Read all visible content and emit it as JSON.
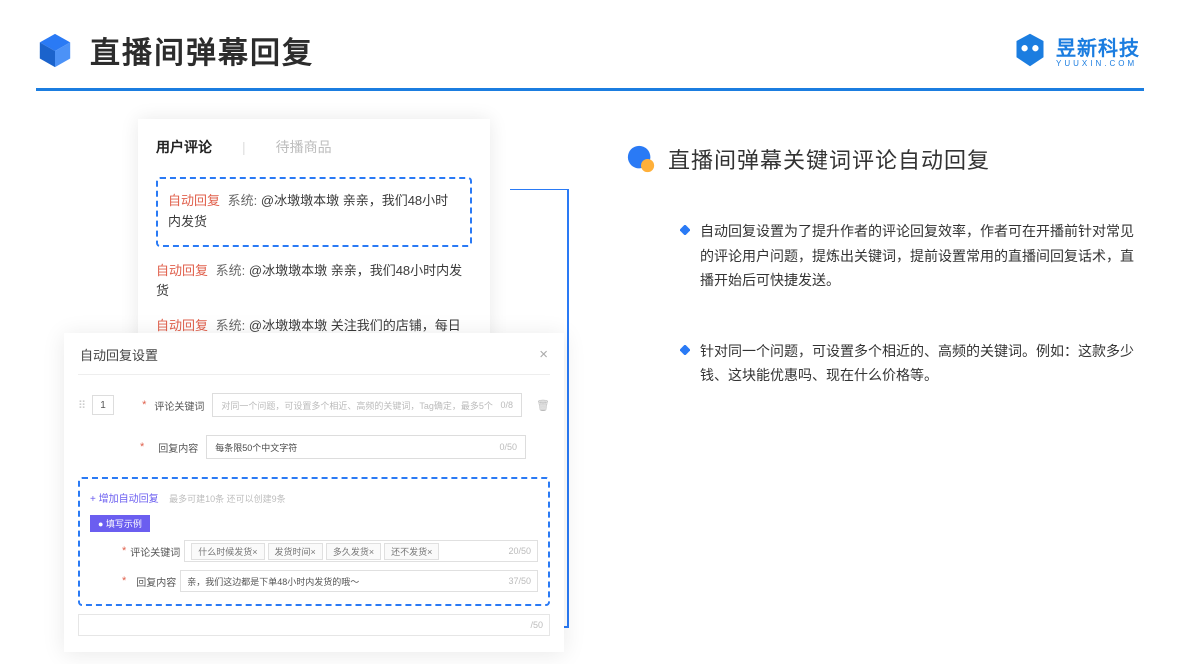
{
  "header": {
    "title": "直播间弹幕回复",
    "brand": {
      "name": "昱新科技",
      "sub": "YUUXIN.COM"
    }
  },
  "commentCard": {
    "tabActive": "用户评论",
    "tabInactive": "待播商品",
    "line1": {
      "badge": "自动回复",
      "sys": "系统:",
      "text": "@冰墩墩本墩 亲亲，我们48小时内发货"
    },
    "line2": {
      "badge": "自动回复",
      "sys": "系统:",
      "text": "@冰墩墩本墩 亲亲，我们48小时内发货"
    },
    "line3": {
      "badge": "自动回复",
      "sys": "系统:",
      "text": "@冰墩墩本墩 关注我们的店铺，每日都有热门推荐呦～"
    }
  },
  "settings": {
    "title": "自动回复设置",
    "index": "1",
    "keywordLabel": "评论关键词",
    "keywordPlaceholder": "对同一个问题，可设置多个相近、高频的关键词，Tag确定，最多5个",
    "keywordCount": "0/8",
    "contentLabel": "回复内容",
    "contentPlaceholder": "每条限50个中文字符",
    "contentCount": "0/50",
    "addLabel": "+ 增加自动回复",
    "addHint": "最多可建10条 还可以创建9条",
    "exampleBadge": "● 填写示例",
    "exKeywordLabel": "评论关键词",
    "tags": [
      "什么时候发货×",
      "发货时间×",
      "多久发货×",
      "还不发货×"
    ],
    "exKeywordCount": "20/50",
    "exContentLabel": "回复内容",
    "exContent": "亲，我们这边都是下单48小时内发货的哦～",
    "exContentCount": "37/50",
    "bareCount": "/50"
  },
  "right": {
    "sectionTitle": "直播间弹幕关键词评论自动回复",
    "bullet1": "自动回复设置为了提升作者的评论回复效率，作者可在开播前针对常见的评论用户问题，提炼出关键词，提前设置常用的直播间回复话术，直播开始后可快捷发送。",
    "bullet2": "针对同一个问题，可设置多个相近的、高频的关键词。例如：这款多少钱、这块能优惠吗、现在什么价格等。"
  }
}
